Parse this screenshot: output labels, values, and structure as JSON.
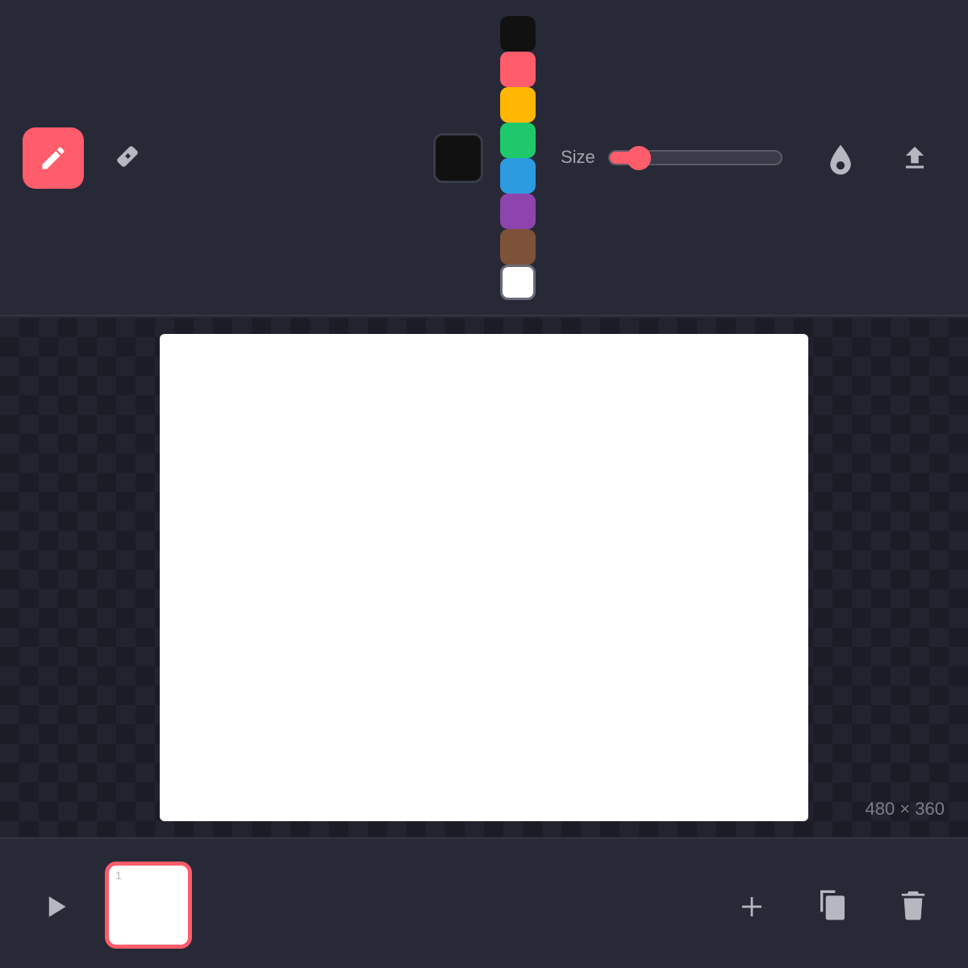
{
  "toolbar": {
    "tools": [
      {
        "name": "brush",
        "icon": "pencil-icon",
        "active": true
      },
      {
        "name": "eraser",
        "icon": "eraser-icon",
        "active": false
      }
    ],
    "current_color": "#111111",
    "palette": [
      {
        "color": "#111111",
        "selected": false
      },
      {
        "color": "#ff5c6c",
        "selected": false
      },
      {
        "color": "#ffb703",
        "selected": false
      },
      {
        "color": "#1fc96b",
        "selected": false
      },
      {
        "color": "#2d9be0",
        "selected": false
      },
      {
        "color": "#8e44ad",
        "selected": false
      },
      {
        "color": "#7d5239",
        "selected": false
      },
      {
        "color": "#ffffff",
        "selected": true
      }
    ],
    "size_label": "Size",
    "size_value": 0.17,
    "fill_icon": "drop-icon",
    "export_icon": "upload-icon"
  },
  "canvas": {
    "dimensions_label": "480 × 360"
  },
  "timeline": {
    "play_icon": "play-icon",
    "frames": [
      {
        "number": "1",
        "active": true
      }
    ],
    "add_icon": "plus-icon",
    "duplicate_icon": "copy-icon",
    "delete_icon": "trash-icon"
  },
  "colors": {
    "accent": "#ff5c6c",
    "background": "#282936"
  }
}
